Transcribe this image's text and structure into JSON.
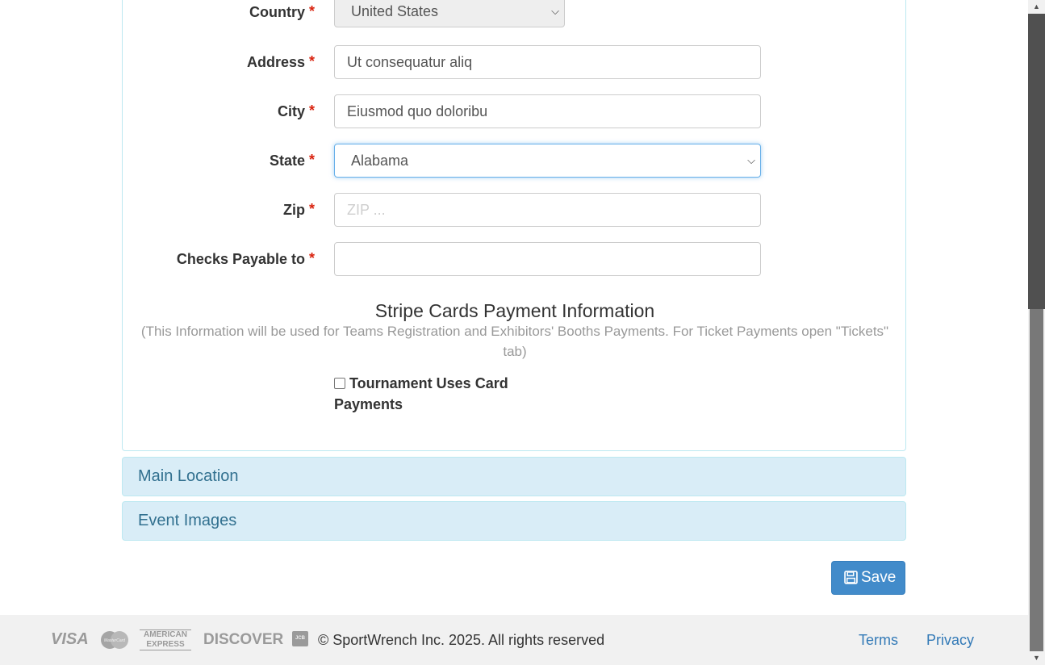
{
  "form": {
    "country": {
      "label": "Country",
      "required": "*",
      "value": "United States"
    },
    "address": {
      "label": "Address",
      "required": "*",
      "value": "Ut consequatur aliq"
    },
    "city": {
      "label": "City",
      "required": "*",
      "value": "Eiusmod quo doloribu"
    },
    "state": {
      "label": "State",
      "required": "*",
      "value": "Alabama"
    },
    "zip": {
      "label": "Zip",
      "required": "*",
      "value": "",
      "placeholder": "ZIP ..."
    },
    "checks_payable": {
      "label": "Checks Payable to",
      "required": "*",
      "value": ""
    }
  },
  "stripe": {
    "title": "Stripe Cards Payment Information",
    "subtitle": "(This Information will be used for Teams Registration and Exhibitors' Booths Payments. For Ticket Payments open \"Tickets\" tab)",
    "checkbox_label": "Tournament Uses Card Payments",
    "checkbox_checked": false
  },
  "accordion": {
    "main_location": "Main Location",
    "event_images": "Event Images"
  },
  "actions": {
    "save_label": "Save"
  },
  "footer": {
    "cards": [
      "VISA",
      "MasterCard",
      "AMERICAN EXPRESS",
      "DISCOVER",
      "JCB"
    ],
    "copyright": "© SportWrench Inc. 2025. All rights reserved",
    "terms": "Terms",
    "privacy": "Privacy"
  },
  "colors": {
    "required": "#d9230f",
    "accordion_bg": "#d9edf7",
    "accordion_text": "#31708f",
    "primary": "#428bca",
    "link": "#337ab7"
  }
}
